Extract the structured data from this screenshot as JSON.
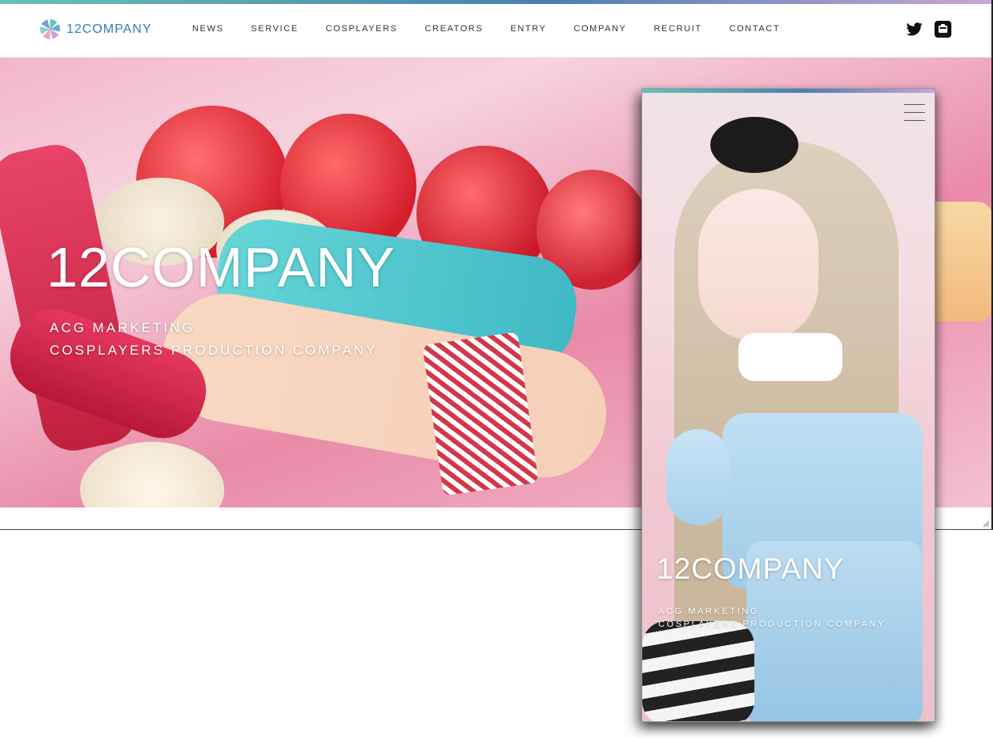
{
  "brand": {
    "logo_text": "12COMPANY",
    "colors": {
      "accent_teal": "#67c1b6",
      "accent_blue": "#2f7fb8",
      "accent_lavender": "#c9a5d8"
    }
  },
  "nav": {
    "items": [
      "NEWS",
      "SERVICE",
      "COSPLAYERS",
      "CREATORS",
      "ENTRY",
      "COMPANY",
      "RECRUIT",
      "CONTACT"
    ]
  },
  "social": {
    "icons": [
      "twitter-icon",
      "instagram-icon"
    ]
  },
  "hero": {
    "title": "12COMPANY",
    "subtitle_line1": "ACG MARKETING",
    "subtitle_line2": "COSPLAYERS PRODUCTION COMPANY"
  },
  "mobile_preview": {
    "menu_icon": "hamburger-menu-icon",
    "title": "12COMPANY",
    "subtitle_line1": "ACG MARKETING",
    "subtitle_line2": "COSPLAYERS PRODUCTION COMPANY"
  }
}
